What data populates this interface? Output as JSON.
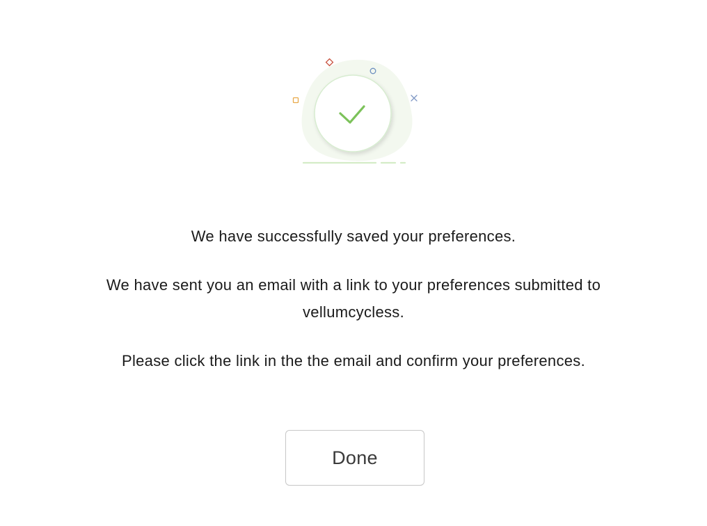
{
  "illustration": {
    "icon": "checkmark-icon",
    "accent_color": "#7cc25a",
    "confetti": [
      "diamond-icon",
      "circle-icon",
      "square-icon",
      "x-icon"
    ]
  },
  "messages": {
    "saved": "We have successfully saved your preferences.",
    "sent": "We have sent you an email with a link to your preferences submitted to vellumcycless.",
    "confirm": "Please click the link in the the email and confirm your preferences."
  },
  "actions": {
    "done_label": "Done"
  }
}
